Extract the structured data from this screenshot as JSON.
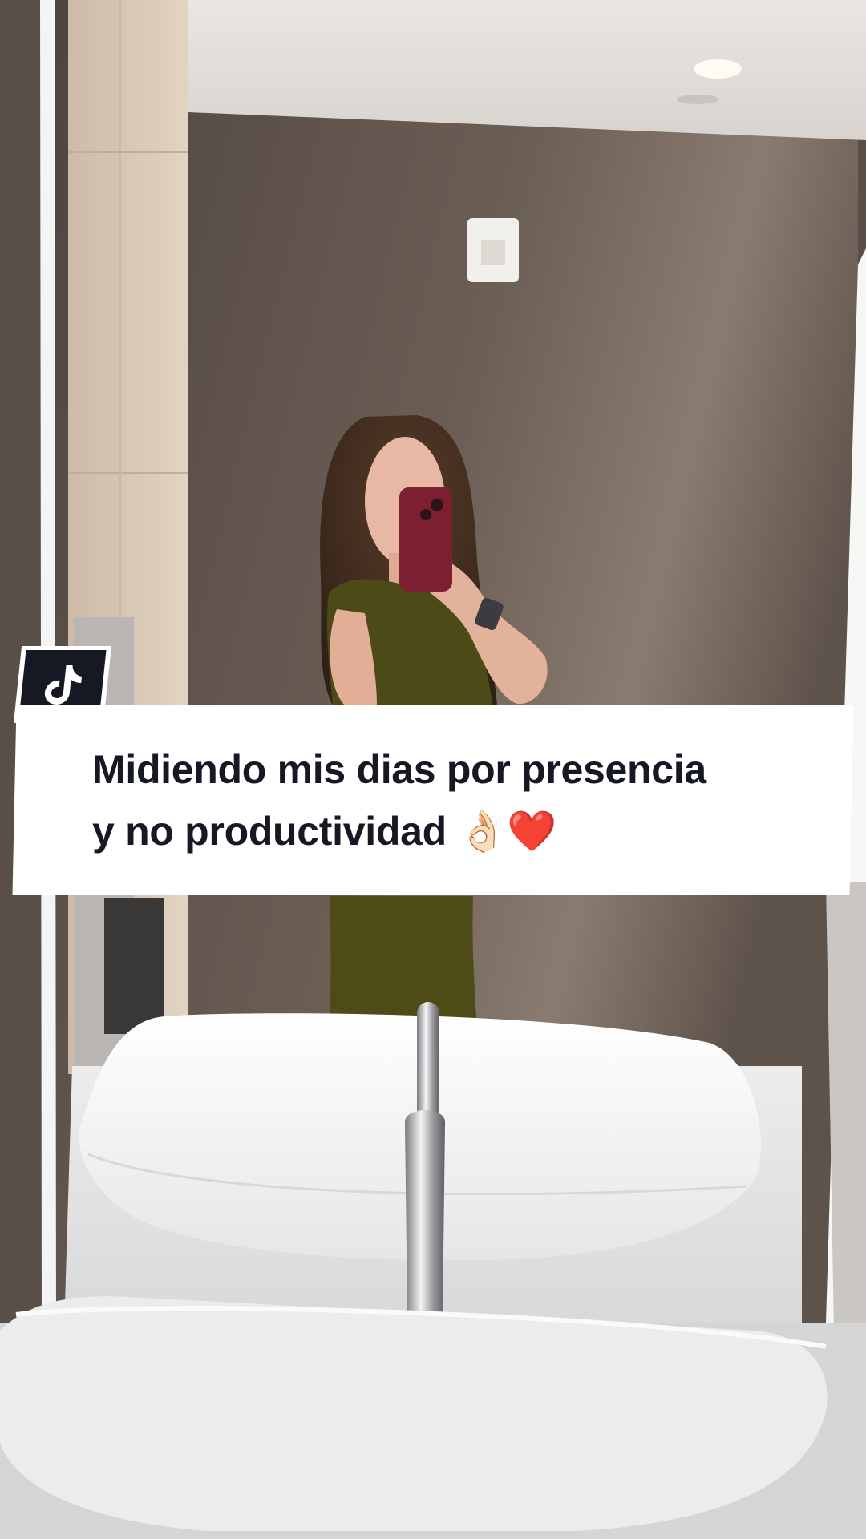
{
  "caption": {
    "line1": "Midiendo mis dias por presencia",
    "line2": "y no productividad",
    "emojis": "👌🏻❤️"
  },
  "badge": {
    "icon": "tiktok-logo-icon"
  },
  "colors": {
    "caption_background": "#ffffff",
    "caption_text": "#161823",
    "badge_background": "#161823",
    "wall": "#5d524b"
  }
}
